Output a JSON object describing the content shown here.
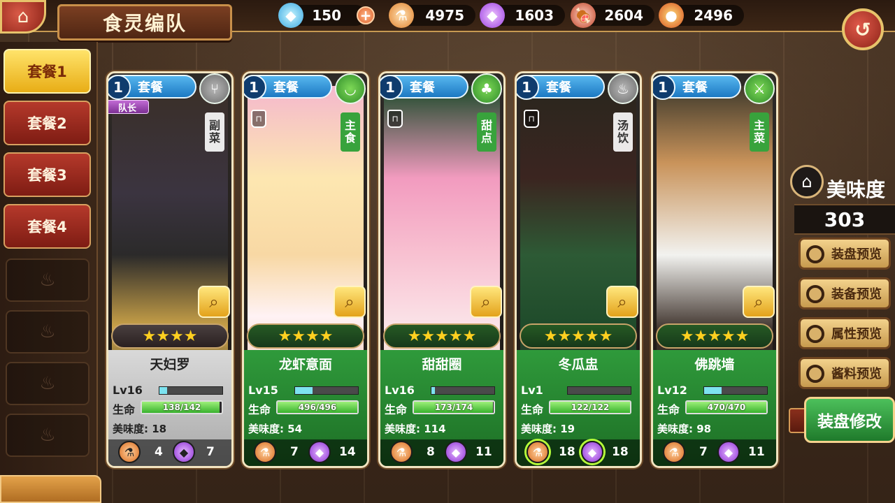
{
  "header": {
    "title": "食灵编队",
    "home_icon": "home-icon",
    "back_icon": "back-icon",
    "resources": [
      {
        "name": "diamond",
        "icon": "diamond-icon",
        "value": "150",
        "has_plus": true
      },
      {
        "name": "potion",
        "icon": "potion-icon",
        "value": "4975"
      },
      {
        "name": "crystal",
        "icon": "crystal-icon",
        "value": "1603"
      },
      {
        "name": "meat",
        "icon": "meat-icon",
        "value": "2604"
      },
      {
        "name": "bomb",
        "icon": "bomb-icon",
        "value": "2496"
      }
    ]
  },
  "tabs": [
    {
      "label": "套餐1",
      "active": true
    },
    {
      "label": "套餐2",
      "active": false
    },
    {
      "label": "套餐3",
      "active": false
    },
    {
      "label": "套餐4",
      "active": false
    }
  ],
  "locked_slots": 4,
  "cards": [
    {
      "set_number": "1",
      "set_label": "套餐",
      "type": "副菜",
      "type_icon": "fork-icon",
      "leader": "队长",
      "name": "天妇罗",
      "level": "Lv16",
      "level_progress": 0.12,
      "hp_label": "生命",
      "hp": "138/142",
      "hp_fraction": 0.97,
      "flavor": "美味度: 18",
      "potion": "4",
      "gem": "7",
      "theme": "grey"
    },
    {
      "set_number": "1",
      "set_label": "套餐",
      "type": "主食",
      "type_icon": "bowl-icon",
      "name": "龙虾意面",
      "level": "Lv15",
      "level_progress": 0.28,
      "hp_label": "生命",
      "hp": "496/496",
      "hp_fraction": 1.0,
      "flavor": "美味度: 54",
      "potion": "7",
      "gem": "14",
      "theme": "green"
    },
    {
      "set_number": "1",
      "set_label": "套餐",
      "type": "甜点",
      "type_icon": "cake-icon",
      "name": "甜甜圈",
      "level": "Lv16",
      "level_progress": 0.05,
      "hp_label": "生命",
      "hp": "173/174",
      "hp_fraction": 0.99,
      "flavor": "美味度: 114",
      "potion": "8",
      "gem": "11",
      "theme": "green"
    },
    {
      "set_number": "1",
      "set_label": "套餐",
      "type": "汤饮",
      "type_icon": "soup-icon",
      "name": "冬瓜盅",
      "level": "Lv1",
      "level_progress": 0.0,
      "hp_label": "生命",
      "hp": "122/122",
      "hp_fraction": 1.0,
      "flavor": "美味度: 19",
      "potion": "18",
      "gem": "18",
      "theme": "green"
    },
    {
      "set_number": "1",
      "set_label": "套餐",
      "type": "主菜",
      "type_icon": "knife-icon",
      "name": "佛跳墙",
      "level": "Lv12",
      "level_progress": 0.28,
      "hp_label": "生命",
      "hp": "470/470",
      "hp_fraction": 1.0,
      "flavor": "美味度: 98",
      "potion": "7",
      "gem": "11",
      "theme": "green"
    }
  ],
  "right_panel": {
    "title": "美味度",
    "score": "303",
    "buttons": [
      "装盘预览",
      "装备预览",
      "属性预览",
      "酱料预览"
    ],
    "modify_label": "装盘修改"
  }
}
